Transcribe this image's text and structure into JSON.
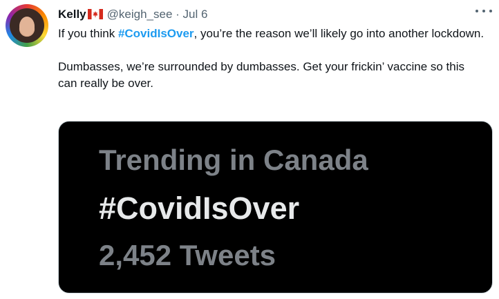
{
  "tweet": {
    "author": {
      "name": "Kelly",
      "flag": "canada-flag-icon",
      "handle": "@keigh_see",
      "separator": "·",
      "date": "Jul 6"
    },
    "body": {
      "p1_before": "If you think ",
      "p1_hashtag": "#CovidIsOver",
      "p1_after": ", you’re the reason we’ll likely go into another lockdown.",
      "p2": "Dumbasses, we’re surrounded by dumbasses. Get your frickin’ vaccine so this can really be over."
    },
    "media": {
      "trending_label": "Trending in Canada",
      "trending_tag": "#CovidIsOver",
      "tweet_count": "2,452 Tweets"
    },
    "colors": {
      "hashtag": "#1d9bf0",
      "muted": "#536471",
      "media_bg": "#000000"
    }
  }
}
